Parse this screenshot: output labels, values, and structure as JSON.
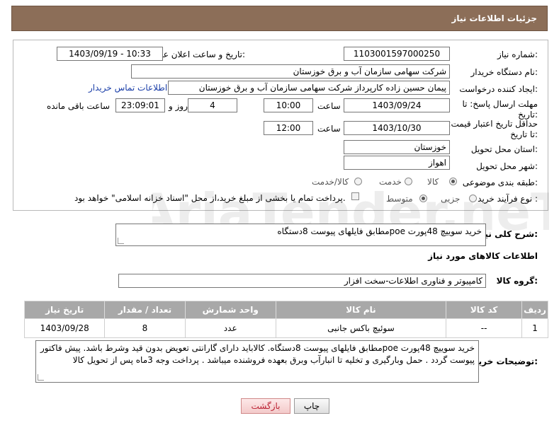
{
  "header": {
    "title": "جزئیات اطلاعات نیاز"
  },
  "form": {
    "need_number_label": "شماره نیاز:",
    "need_number": "1103001597000250",
    "announce_label": "تاریخ و ساعت اعلان عمومی:",
    "announce_value": "1403/09/19 - 10:33",
    "buyer_org_label": "نام دستگاه خریدار:",
    "buyer_org": "شرکت سهامی سازمان آب و برق خوزستان",
    "creator_label": "ایجاد کننده درخواست:",
    "creator": "پیمان حسین زاده کارپرداز شرکت سهامی سازمان آب و برق خوزستان",
    "contact_link": "اطلاعات تماس خریدار",
    "deadline_label": "مهلت ارسال پاسخ: تا تاریخ:",
    "deadline_date": "1403/09/24",
    "time_label": "ساعت",
    "deadline_time": "10:00",
    "days_value": "4",
    "days_label": "روز و",
    "remaining_time": "23:09:01",
    "remaining_label": "ساعت باقی مانده",
    "min_validity_label": "حداقل تاریخ اعتبار قیمت: تا تاریخ:",
    "validity_date": "1403/10/30",
    "validity_time": "12:00",
    "province_label": "استان محل تحویل:",
    "province": "خوزستان",
    "city_label": "شهر محل تحویل:",
    "city": "اهواز",
    "category_label": "طبقه بندی موضوعی:",
    "category_options": [
      "کالا",
      "خدمت",
      "کالا/خدمت"
    ],
    "process_label": "نوع فرآیند خرید :",
    "process_options": [
      "جزیی",
      "متوسط"
    ],
    "payment_note": "پرداخت تمام یا بخشی از مبلغ خرید،از محل \"اسناد خزانه اسلامی\" خواهد بود."
  },
  "summary": {
    "label": "شرح کلی نیاز:",
    "text": "خرید سوییچ 48پورت poeمطابق فایلهای پیوست 8دستگاه"
  },
  "goods_info": {
    "title": "اطلاعات کالاهای مورد نیاز"
  },
  "goods_group": {
    "label": "گروه کالا:",
    "value": "کامپیوتر و فناوری اطلاعات-سخت افزار"
  },
  "table": {
    "headers": [
      "ردیف",
      "کد کالا",
      "نام کالا",
      "واحد شمارش",
      "تعداد / مقدار",
      "تاریخ نیاز"
    ],
    "rows": [
      {
        "row": "1",
        "code": "--",
        "name": "سوئیچ باکس جانبی",
        "unit": "عدد",
        "qty": "8",
        "date": "1403/09/28"
      }
    ]
  },
  "buyer_notes": {
    "label": "توضیحات خریدار:",
    "text": "خرید سوییچ 48پورت poeمطابق فایلهای پیوست 8دستگاه. کالاباید دارای گارانتی تعویض بدون قید وشرط باشد. پیش فاکتور پیوست گردد . حمل وبارگیری و تخلیه تا انبارآب وبرق بعهده فروشنده میباشد . پرداخت وجه 3ماه پس از تحویل کالا"
  },
  "buttons": {
    "print": "چاپ",
    "back": "بازگشت"
  },
  "watermark_text": "AriaTender.neT",
  "colors": {
    "header": "#8c6e58",
    "table_header": "#a8a8a8",
    "link": "#1a3ea8"
  }
}
